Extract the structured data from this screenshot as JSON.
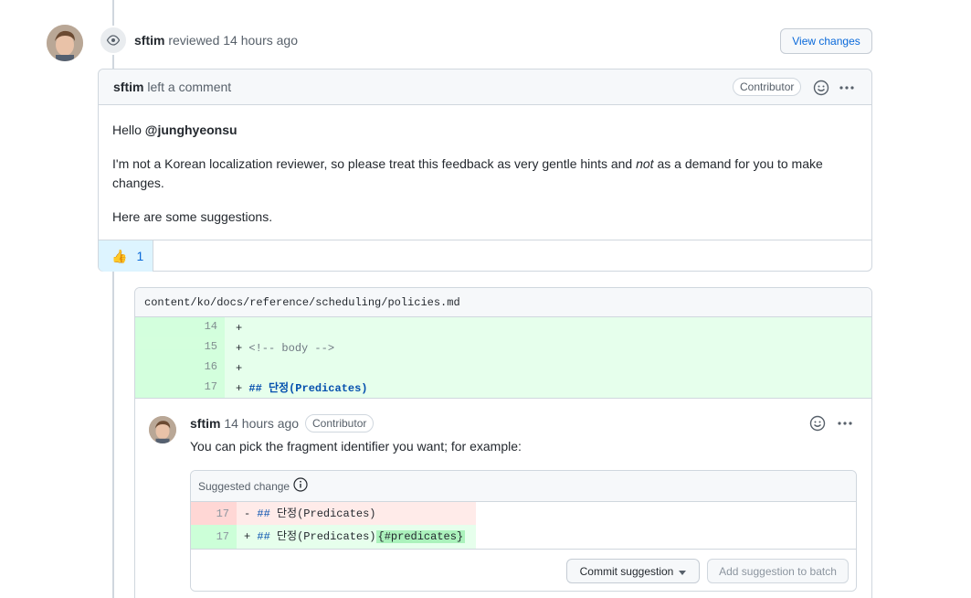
{
  "review": {
    "author": "sftim",
    "action": "reviewed",
    "time": "14 hours ago",
    "view_changes_label": "View changes"
  },
  "comment": {
    "author": "sftim",
    "action": "left a comment",
    "badge": "Contributor",
    "greeting_prefix": "Hello",
    "mention": "@junghyeonsu",
    "para1_a": "I'm not a Korean localization reviewer, so please treat this feedback as very gentle hints and",
    "para1_em": "not",
    "para1_b": "as a demand for you to make changes.",
    "para2": "Here are some suggestions.",
    "reaction_count": "1"
  },
  "file": {
    "path": "content/ko/docs/reference/scheduling/policies.md",
    "lines": [
      {
        "num": "14",
        "sign": "+",
        "text": ""
      },
      {
        "num": "15",
        "sign": "+",
        "text": "<!-- body -->"
      },
      {
        "num": "16",
        "sign": "+",
        "text": ""
      },
      {
        "num": "17",
        "sign": "+",
        "text": "## 단정(Predicates)"
      }
    ]
  },
  "thread": {
    "author": "sftim",
    "time": "14 hours ago",
    "badge": "Contributor",
    "text": "You can pick the fragment identifier you want; for example:",
    "suggestion_title": "Suggested change",
    "del_num": "17",
    "del_sign": "-",
    "del_hash": "##",
    "del_rest": "단정(Predicates)",
    "add_num": "17",
    "add_sign": "+",
    "add_hash": "##",
    "add_rest": "단정(Predicates)",
    "add_highlight": "{#predicates}",
    "commit_label": "Commit suggestion",
    "batch_label": "Add suggestion to batch"
  }
}
